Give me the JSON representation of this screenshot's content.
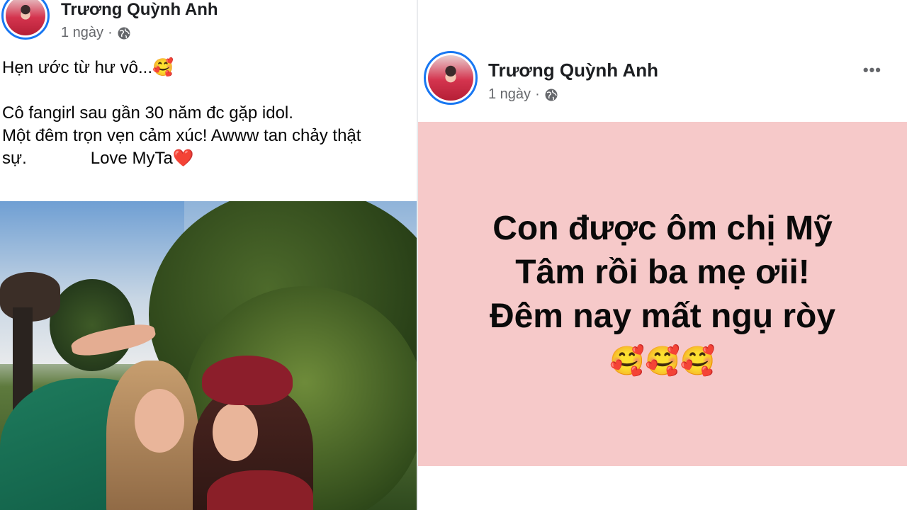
{
  "left_post": {
    "author_name": "Trương Quỳnh Anh",
    "timestamp": "1 ngày",
    "separator": "·",
    "privacy_icon": "globe-icon",
    "caption_line1": "Hẹn ước từ hư vô...🥰",
    "caption_line2": "Cô fangirl sau gần 30 năm đc gặp idol.",
    "caption_line3": "Một đêm trọn vẹn cảm xúc! Awww tan chảy thật",
    "caption_line4_start": "sự.",
    "caption_line4_love": "Love MyTa❤️"
  },
  "right_post": {
    "author_name": "Trương Quỳnh Anh",
    "timestamp": "1 ngày",
    "separator": "·",
    "privacy_icon": "globe-icon",
    "more_label": "•••",
    "background_color": "#f6c9c9",
    "text_line1": "Con được ôm chị Mỹ",
    "text_line2": "Tâm rồi ba mẹ ơii!",
    "text_line3": "Đêm nay mất ngụ ròy",
    "emojis": "🥰🥰🥰"
  },
  "colors": {
    "avatar_ring": "#1877f2",
    "name_text": "#1c1e21",
    "meta_text": "#65676b"
  }
}
